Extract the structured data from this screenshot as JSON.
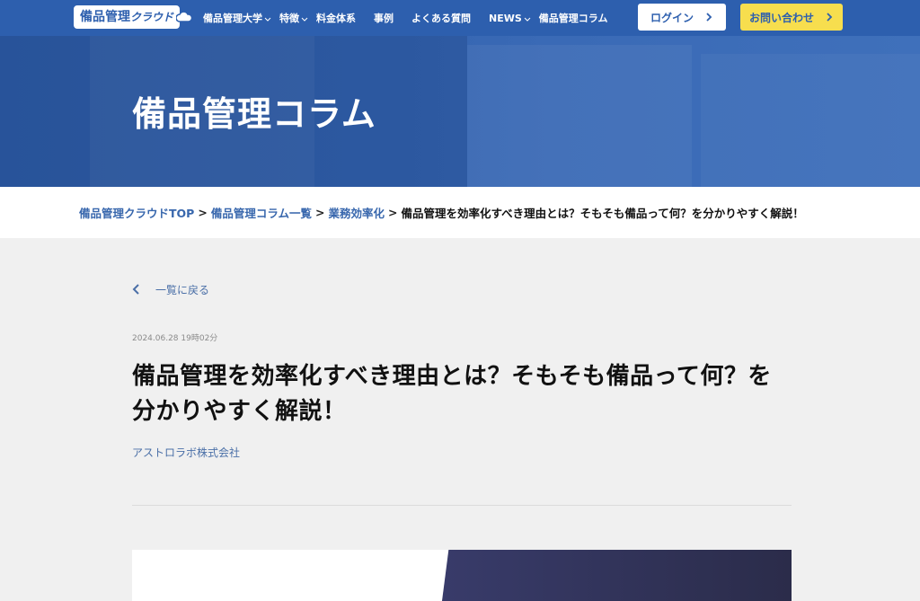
{
  "header": {
    "logo_text": "備品管理",
    "logo_kana": "クラウド",
    "nav": [
      {
        "label": "備品管理大学",
        "has_dropdown": true
      },
      {
        "label": "特徴",
        "has_dropdown": true
      },
      {
        "label": "料金体系",
        "has_dropdown": false
      },
      {
        "label": "事例",
        "has_dropdown": false
      },
      {
        "label": "よくある質問",
        "has_dropdown": false
      },
      {
        "label": "NEWS",
        "has_dropdown": true
      },
      {
        "label": "備品管理コラム",
        "has_dropdown": false
      }
    ],
    "login_label": "ログイン",
    "contact_label": "お問い合わせ"
  },
  "hero": {
    "title": "備品管理コラム"
  },
  "breadcrumb": {
    "items": [
      {
        "label": "備品管理クラウドTOP"
      },
      {
        "label": "備品管理コラム一覧"
      },
      {
        "label": "業務効率化"
      }
    ],
    "separator": ">",
    "current": "備品管理を効率化すべき理由とは？そもそも備品って何？を分かりやすく解説！"
  },
  "article": {
    "back_label": "一覧に戻る",
    "date": "2024.06.28 19時02分",
    "title": "備品管理を効率化すべき理由とは？そもそも備品って何？を分かりやすく解説！",
    "company": "アストロラボ株式会社"
  },
  "colors": {
    "brand_blue": "#2d5fae",
    "link_blue": "#3867ad",
    "contact_yellow": "#f7de4e"
  }
}
